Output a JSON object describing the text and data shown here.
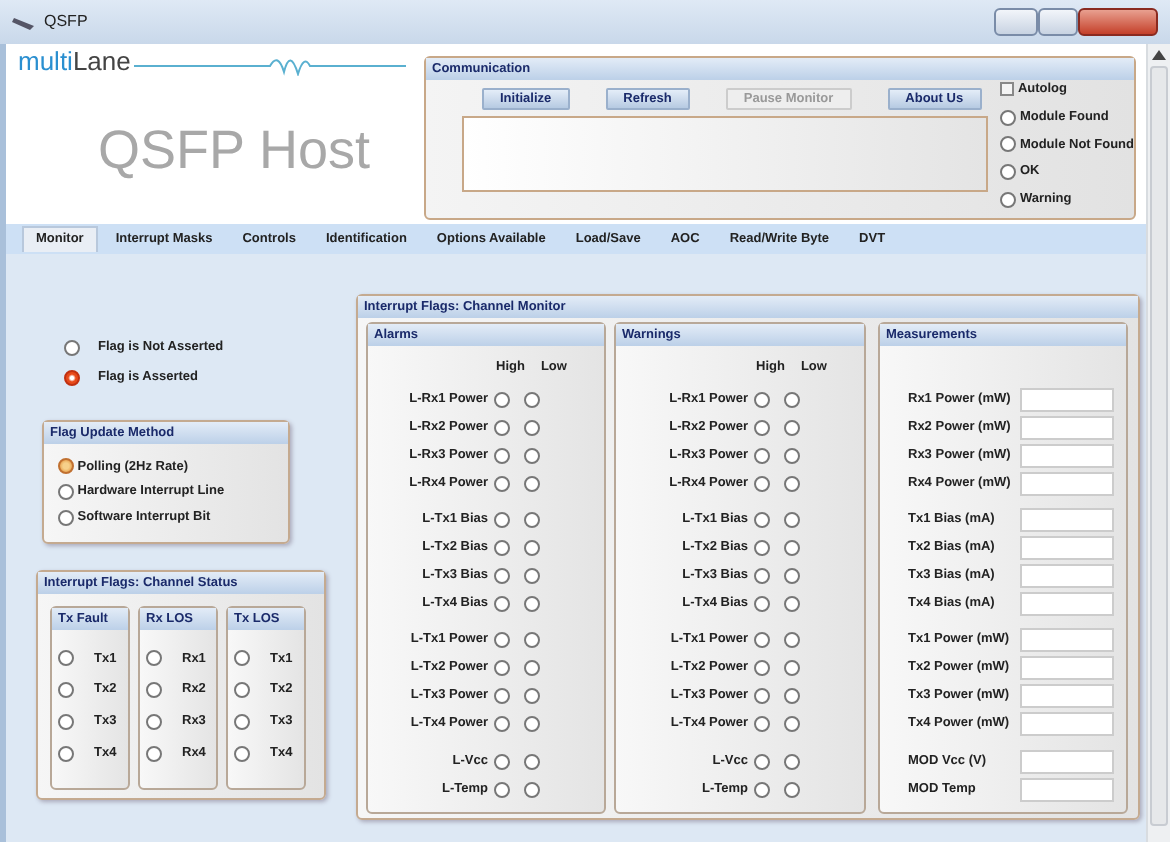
{
  "window": {
    "title": "QSFP"
  },
  "logo": {
    "part1": "multi",
    "part2": "Lane"
  },
  "app_title": "QSFP Host",
  "communication": {
    "title": "Communication",
    "buttons": [
      {
        "label": "Initialize",
        "disabled": false
      },
      {
        "label": "Refresh",
        "disabled": false
      },
      {
        "label": "Pause Monitor",
        "disabled": true
      },
      {
        "label": "About Us",
        "disabled": false
      }
    ],
    "autolog": {
      "label": "Autolog",
      "checked": false
    },
    "status": [
      {
        "label": "Module Found",
        "selected": false
      },
      {
        "label": "Module Not Found",
        "selected": false
      },
      {
        "label": "OK",
        "selected": false
      },
      {
        "label": "Warning",
        "selected": false
      }
    ]
  },
  "tabs": [
    {
      "label": "Monitor",
      "selected": true
    },
    {
      "label": "Interrupt Masks",
      "selected": false
    },
    {
      "label": "Controls",
      "selected": false
    },
    {
      "label": "Identification",
      "selected": false
    },
    {
      "label": "Options Available",
      "selected": false
    },
    {
      "label": "Load/Save",
      "selected": false
    },
    {
      "label": "AOC",
      "selected": false
    },
    {
      "label": "Read/Write Byte",
      "selected": false
    },
    {
      "label": "DVT",
      "selected": false
    }
  ],
  "legend": [
    {
      "label": "Flag is Not Asserted",
      "asserted": false
    },
    {
      "label": "Flag is Asserted",
      "asserted": true
    }
  ],
  "flag_update_method": {
    "title": "Flag Update Method",
    "options": [
      {
        "label": "Polling (2Hz Rate)",
        "selected": true
      },
      {
        "label": "Hardware Interrupt Line",
        "selected": false
      },
      {
        "label": "Software Interrupt Bit",
        "selected": false
      }
    ]
  },
  "channel_status": {
    "title": "Interrupt Flags: Channel Status",
    "columns": [
      {
        "title": "Tx Fault",
        "items": [
          {
            "label": "Tx1",
            "asserted": false
          },
          {
            "label": "Tx2",
            "asserted": false
          },
          {
            "label": "Tx3",
            "asserted": false
          },
          {
            "label": "Tx4",
            "asserted": false
          }
        ]
      },
      {
        "title": "Rx LOS",
        "items": [
          {
            "label": "Rx1",
            "asserted": false
          },
          {
            "label": "Rx2",
            "asserted": false
          },
          {
            "label": "Rx3",
            "asserted": false
          },
          {
            "label": "Rx4",
            "asserted": false
          }
        ]
      },
      {
        "title": "Tx LOS",
        "items": [
          {
            "label": "Tx1",
            "asserted": false
          },
          {
            "label": "Tx2",
            "asserted": false
          },
          {
            "label": "Tx3",
            "asserted": false
          },
          {
            "label": "Tx4",
            "asserted": false
          }
        ]
      }
    ]
  },
  "channel_monitor": {
    "title": "Interrupt Flags: Channel Monitor",
    "alarms": {
      "title": "Alarms",
      "col_high": "High",
      "col_low": "Low",
      "groups": [
        [
          {
            "label": "L-Rx1 Power",
            "high": false,
            "low": false
          },
          {
            "label": "L-Rx2 Power",
            "high": false,
            "low": false
          },
          {
            "label": "L-Rx3 Power",
            "high": false,
            "low": false
          },
          {
            "label": "L-Rx4 Power",
            "high": false,
            "low": false
          }
        ],
        [
          {
            "label": "L-Tx1 Bias",
            "high": false,
            "low": false
          },
          {
            "label": "L-Tx2 Bias",
            "high": false,
            "low": false
          },
          {
            "label": "L-Tx3 Bias",
            "high": false,
            "low": false
          },
          {
            "label": "L-Tx4 Bias",
            "high": false,
            "low": false
          }
        ],
        [
          {
            "label": "L-Tx1 Power",
            "high": false,
            "low": false
          },
          {
            "label": "L-Tx2 Power",
            "high": false,
            "low": false
          },
          {
            "label": "L-Tx3 Power",
            "high": false,
            "low": false
          },
          {
            "label": "L-Tx4 Power",
            "high": false,
            "low": false
          }
        ],
        [
          {
            "label": "L-Vcc",
            "high": false,
            "low": false
          },
          {
            "label": "L-Temp",
            "high": false,
            "low": false
          }
        ]
      ]
    },
    "warnings": {
      "title": "Warnings",
      "col_high": "High",
      "col_low": "Low",
      "groups": [
        [
          {
            "label": "L-Rx1 Power",
            "high": false,
            "low": false
          },
          {
            "label": "L-Rx2 Power",
            "high": false,
            "low": false
          },
          {
            "label": "L-Rx3 Power",
            "high": false,
            "low": false
          },
          {
            "label": "L-Rx4 Power",
            "high": false,
            "low": false
          }
        ],
        [
          {
            "label": "L-Tx1 Bias",
            "high": false,
            "low": false
          },
          {
            "label": "L-Tx2 Bias",
            "high": false,
            "low": false
          },
          {
            "label": "L-Tx3 Bias",
            "high": false,
            "low": false
          },
          {
            "label": "L-Tx4 Bias",
            "high": false,
            "low": false
          }
        ],
        [
          {
            "label": "L-Tx1 Power",
            "high": false,
            "low": false
          },
          {
            "label": "L-Tx2 Power",
            "high": false,
            "low": false
          },
          {
            "label": "L-Tx3 Power",
            "high": false,
            "low": false
          },
          {
            "label": "L-Tx4 Power",
            "high": false,
            "low": false
          }
        ],
        [
          {
            "label": "L-Vcc",
            "high": false,
            "low": false
          },
          {
            "label": "L-Temp",
            "high": false,
            "low": false
          }
        ]
      ]
    },
    "measurements": {
      "title": "Measurements",
      "groups": [
        [
          {
            "label": "Rx1 Power (mW)"
          },
          {
            "label": "Rx2 Power (mW)"
          },
          {
            "label": "Rx3 Power (mW)"
          },
          {
            "label": "Rx4 Power (mW)"
          }
        ],
        [
          {
            "label": "Tx1 Bias (mA)"
          },
          {
            "label": "Tx2 Bias (mA)"
          },
          {
            "label": "Tx3 Bias (mA)"
          },
          {
            "label": "Tx4 Bias (mA)"
          }
        ],
        [
          {
            "label": "Tx1 Power (mW)"
          },
          {
            "label": "Tx2 Power (mW)"
          },
          {
            "label": "Tx3 Power (mW)"
          },
          {
            "label": "Tx4 Power (mW)"
          }
        ],
        [
          {
            "label": "MOD Vcc (V)"
          },
          {
            "label": "MOD Temp"
          }
        ]
      ]
    }
  }
}
